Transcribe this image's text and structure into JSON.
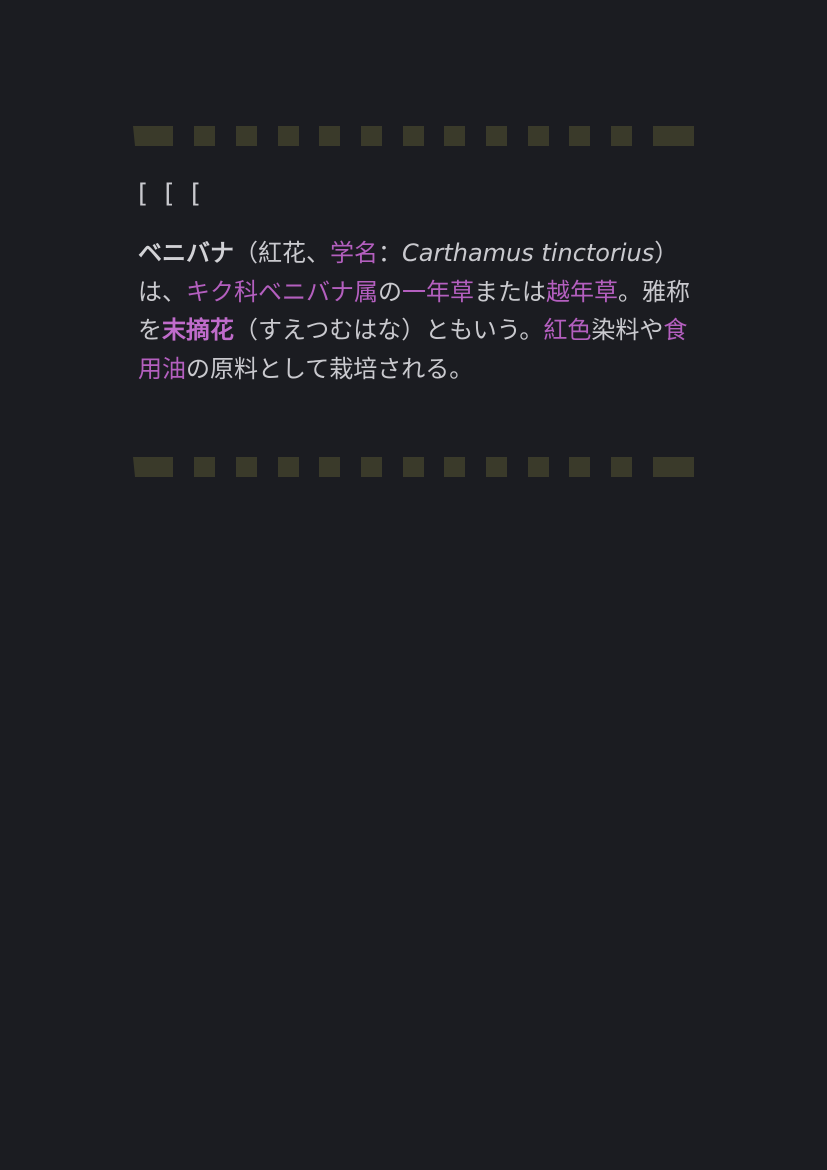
{
  "header": {
    "brackets": "[ [ ["
  },
  "article": {
    "term": "ベニバナ",
    "p1": "（紅花、",
    "link_scientific_name": "学名",
    "p2": "：",
    "latin_1": "Carthamus",
    "p3": " ",
    "latin_2": "tinctorius",
    "p4": "）は、",
    "link_family": "キク科",
    "link_genus": "ベニバナ属",
    "p5": "の",
    "link_annual": "一年草",
    "p6": "または",
    "link_biennial": "越年草",
    "p7": "。雅称を",
    "link_elegant_name": "末摘花",
    "p8": "（すえつむはな）ともいう。",
    "link_red": "紅色",
    "p9": "染料や",
    "link_oil": "食用油",
    "p10": "の原料として栽培される。"
  },
  "colors": {
    "background": "#1b1c21",
    "text": "#c9c9ce",
    "link": "#b45fbf",
    "tape": "#3a3a2a"
  }
}
